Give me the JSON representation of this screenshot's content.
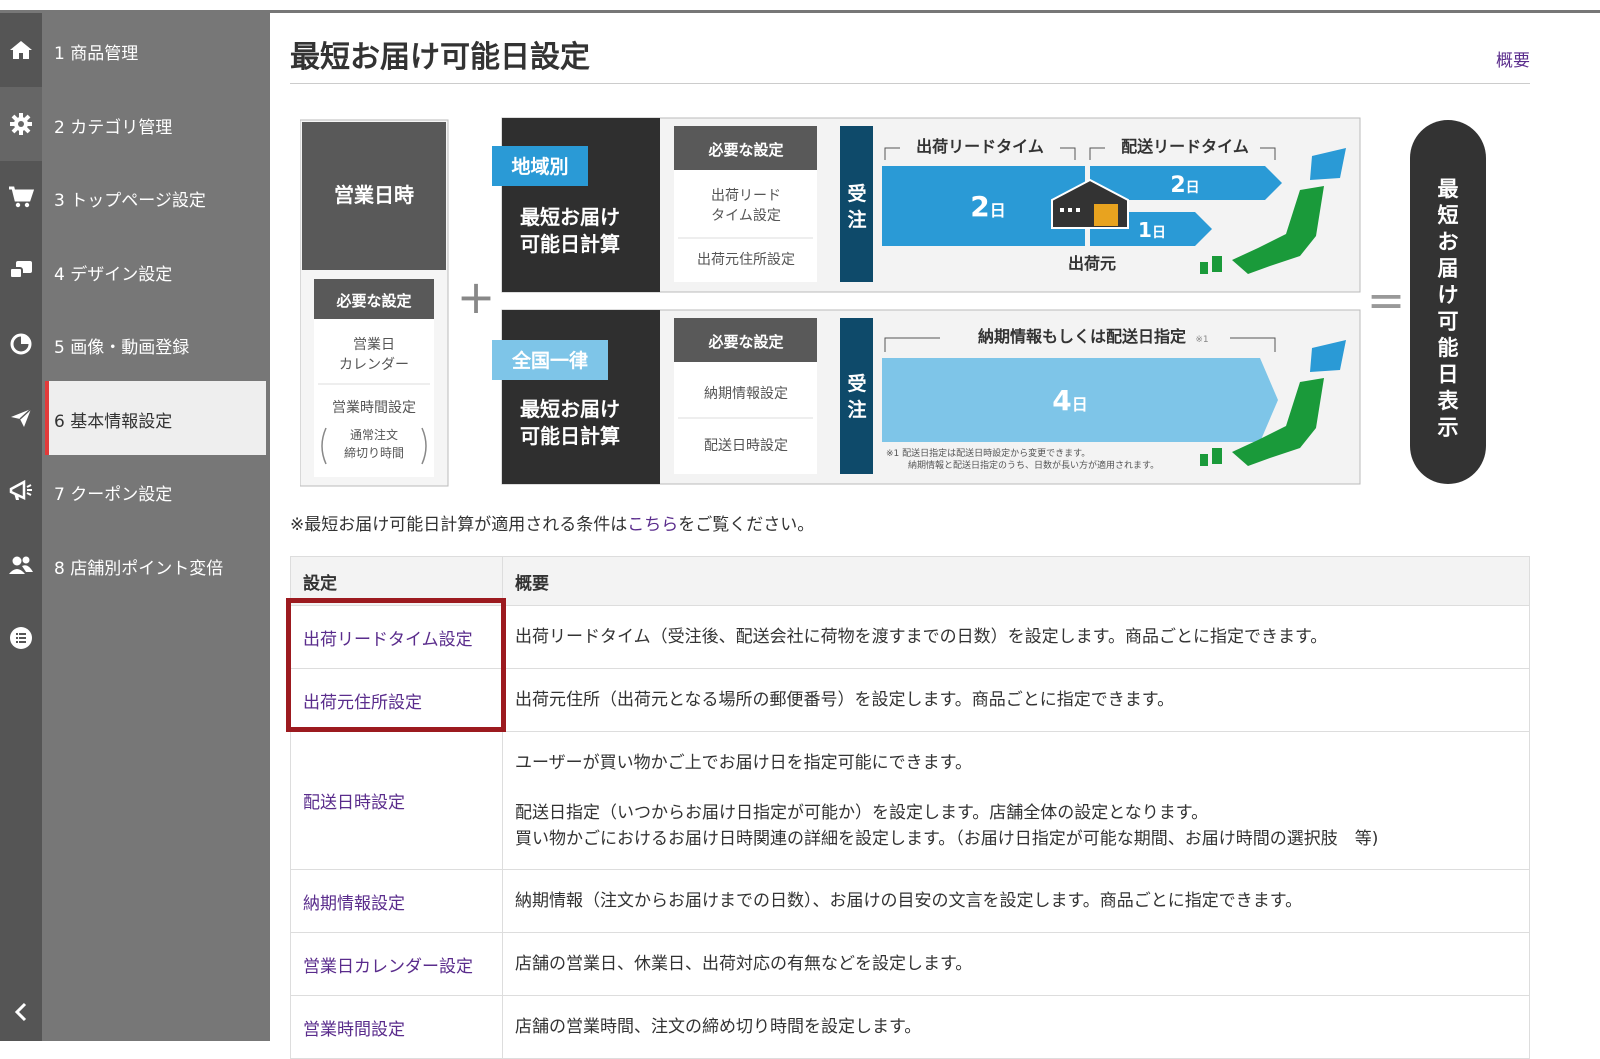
{
  "sidebar": {
    "items": [
      {
        "label": "1 商品管理",
        "icon": "home-icon"
      },
      {
        "label": "2 カテゴリ管理",
        "icon": "gear-icon"
      },
      {
        "label": "3 トップページ設定",
        "icon": "cart-icon"
      },
      {
        "label": "4 デザイン設定",
        "icon": "design-icon"
      },
      {
        "label": "5 画像・動画登録",
        "icon": "pie-icon"
      },
      {
        "label": "6 基本情報設定",
        "icon": "paper-plane-icon"
      },
      {
        "label": "7 クーポン設定",
        "icon": "megaphone-icon"
      },
      {
        "label": "8 店舗別ポイント変倍",
        "icon": "users-icon"
      }
    ],
    "extra_icon": "list-icon",
    "collapse_icon": "chevron-left-icon"
  },
  "header": {
    "title": "最短お届け可能日設定",
    "summary_link": "概要"
  },
  "diagram": {
    "biz_title": "営業日時",
    "required_label": "必要な設定",
    "biz_req_1a": "営業日",
    "biz_req_1b": "カレンダー",
    "biz_req_2": "営業時間設定",
    "biz_req_3a": "通常注文",
    "biz_req_3b": "締切り時間",
    "plus": "+",
    "equals": "=",
    "region_tag": "地域別",
    "nation_tag": "全国一律",
    "calc_1": "最短お届け",
    "calc_2": "可能日計算",
    "row1_req_1a": "出荷リード",
    "row1_req_1b": "タイム設定",
    "row1_req_2": "出荷元住所設定",
    "row2_req_1": "納期情報設定",
    "row2_req_2": "配送日時設定",
    "order_1": "受",
    "order_2": "注",
    "ship_lead": "出荷リードタイム",
    "delivery_lead": "配送リードタイム",
    "days_2": "2",
    "days_1": "1",
    "days_4": "4",
    "day_unit": "日",
    "origin": "出荷元",
    "delivery_info": "納期情報もしくは配送日指定",
    "note_mark": "※1",
    "footnote_1": "※1 配送日指定は配送日時設定から変更できます。",
    "footnote_2": "納期情報と配送日指定のうち、日数が長い方が適用されます。",
    "result_label": "最短お届け可能日表示"
  },
  "note": {
    "prefix": "※最短お届け可能日計算が適用される条件は",
    "link": "こちら",
    "suffix": "をご覧ください。"
  },
  "table": {
    "headers": [
      "設定",
      "概要"
    ],
    "rows": [
      {
        "name": "出荷リードタイム設定",
        "desc": [
          "出荷リードタイム（受注後、配送会社に荷物を渡すまでの日数）を設定します。商品ごとに指定できます。"
        ]
      },
      {
        "name": "出荷元住所設定",
        "desc": [
          "出荷元住所（出荷元となる場所の郵便番号）を設定します。商品ごとに指定できます。"
        ]
      },
      {
        "name": "配送日時設定",
        "desc": [
          "ユーザーが買い物かご上でお届け日を指定可能にできます。",
          "配送日指定（いつからお届け日指定が可能か）を設定します。店舗全体の設定となります。",
          "買い物かごにおけるお届け日時関連の詳細を設定します。（お届け日指定が可能な期間、お届け時間の選択肢　等)"
        ]
      },
      {
        "name": "納期情報設定",
        "desc": [
          "納期情報（注文からお届けまでの日数）、お届けの目安の文言を設定します。商品ごとに指定できます。"
        ]
      },
      {
        "name": "営業日カレンダー設定",
        "desc": [
          "店舗の営業日、休業日、出荷対応の有無などを設定します。"
        ]
      },
      {
        "name": "営業時間設定",
        "desc": [
          "店舗の営業時間、注文の締め切り時間を設定します。"
        ]
      }
    ]
  },
  "colors": {
    "accent_purple": "#5a2c8c",
    "highlight_red": "#9c1a1f",
    "diagram_blue": "#2a9ad6",
    "diagram_light_blue": "#7ec5e8",
    "diagram_navy": "#0e4a6a",
    "japan_green": "#1a9a3a"
  }
}
